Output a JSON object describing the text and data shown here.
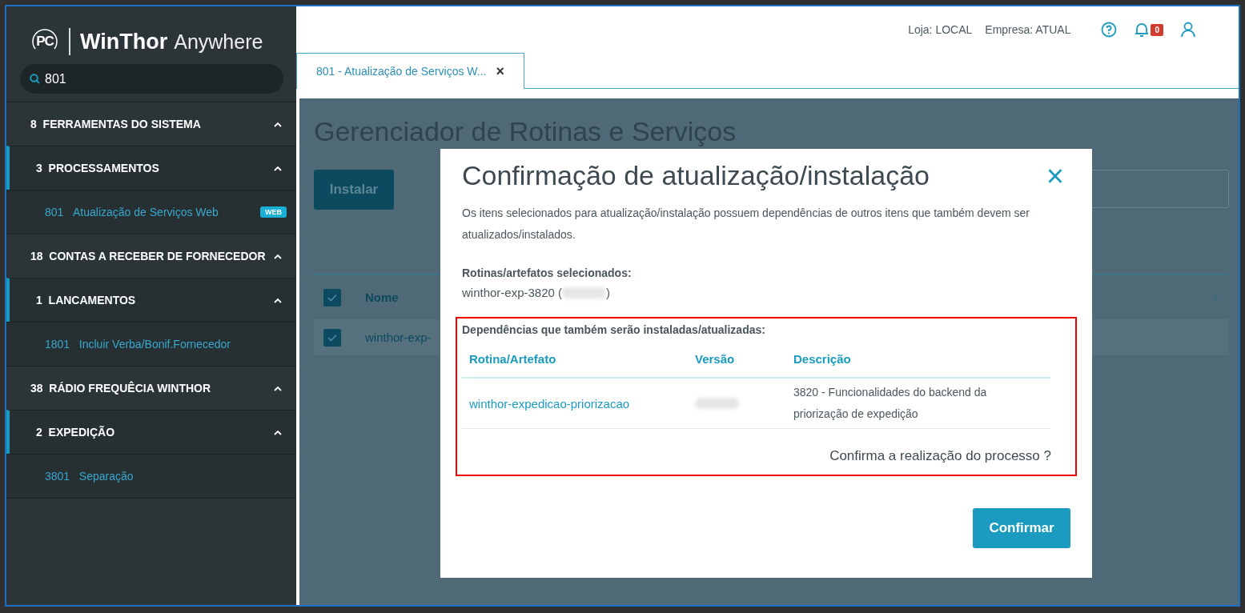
{
  "sidebar": {
    "logo": {
      "mark": "PC",
      "brand": "WinThor",
      "product": "Anywhere"
    },
    "search": {
      "value": "801"
    },
    "items": [
      {
        "code": "8",
        "label": "FERRAMENTAS DO SISTEMA",
        "expanded": true,
        "children": [
          {
            "code": "3",
            "label": "PROCESSAMENTOS",
            "expanded": true,
            "children": [
              {
                "code": "801",
                "label": "Atualização de Serviços Web",
                "badge": "WEB"
              }
            ]
          }
        ]
      },
      {
        "code": "18",
        "label": "CONTAS A RECEBER DE FORNECEDOR",
        "expanded": true,
        "children": [
          {
            "code": "1",
            "label": "LANCAMENTOS",
            "expanded": true,
            "children": [
              {
                "code": "1801",
                "label": "Incluir Verba/Bonif.Fornecedor"
              }
            ]
          }
        ]
      },
      {
        "code": "38",
        "label": "RÁDIO FREQUÊCIA WINTHOR",
        "expanded": true,
        "children": [
          {
            "code": "2",
            "label": "EXPEDIÇÃO",
            "expanded": true,
            "children": [
              {
                "code": "3801",
                "label": "Separação"
              }
            ]
          }
        ]
      }
    ]
  },
  "header": {
    "store": "Loja: LOCAL",
    "company": "Empresa: ATUAL",
    "notifications": "0"
  },
  "tabs": [
    {
      "label": "801 - Atualização de Serviços W...",
      "close": "×",
      "selected": true
    }
  ],
  "page": {
    "title": "Gerenciador de Rotinas e Serviços",
    "install_button": "Instalar",
    "table": {
      "header": {
        "checked": true,
        "label": "Nome"
      },
      "rows": [
        {
          "checked": true,
          "name": "winthor-exp-"
        }
      ]
    }
  },
  "dialog": {
    "title": "Confirmação de atualização/instalação",
    "close": "×",
    "message": "Os itens selecionados para atualização/instalação possuem dependências de outros itens que também devem ser atualizados/instalados.",
    "selected_heading": "Rotinas/artefatos selecionados:",
    "selected_item": {
      "prefix": "winthor-exp-3820 (",
      "suffix": ")"
    },
    "dependencies_heading": "Dependências que também serão instaladas/atualizadas:",
    "columns": [
      "Rotina/Artefato",
      "Versão",
      "Descrição"
    ],
    "rows": [
      {
        "artifact": "winthor-expedicao-priorizacao",
        "description": "3820 - Funcionalidades do backend da priorização de expedição"
      }
    ],
    "question": "Confirma a realização do processo ?",
    "confirm_button": "Confirmar"
  }
}
